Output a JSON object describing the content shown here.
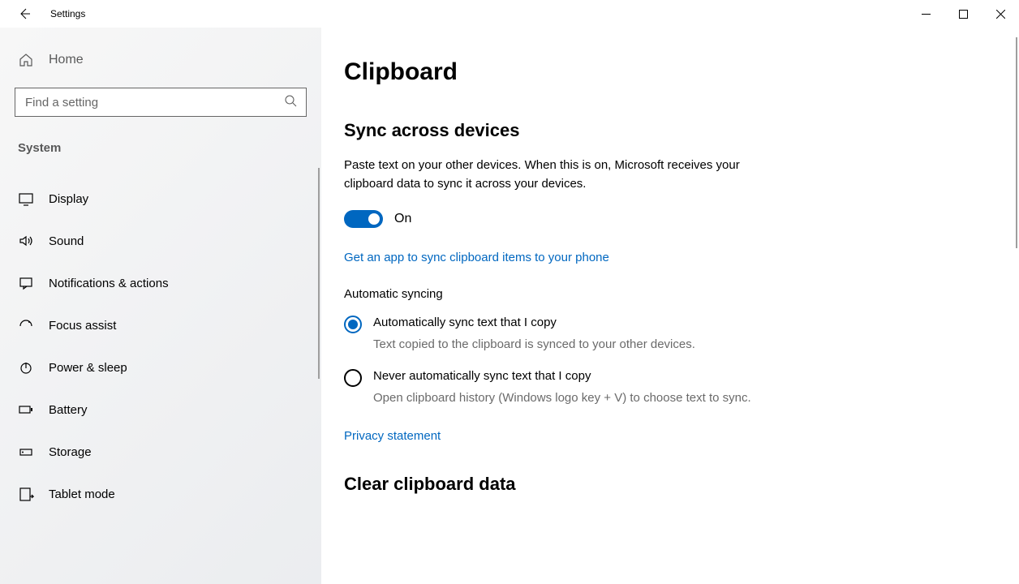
{
  "titlebar": {
    "title": "Settings"
  },
  "sidebar": {
    "home": "Home",
    "search_placeholder": "Find a setting",
    "category": "System",
    "items": [
      {
        "label": "Display"
      },
      {
        "label": "Sound"
      },
      {
        "label": "Notifications & actions"
      },
      {
        "label": "Focus assist"
      },
      {
        "label": "Power & sleep"
      },
      {
        "label": "Battery"
      },
      {
        "label": "Storage"
      },
      {
        "label": "Tablet mode"
      }
    ]
  },
  "main": {
    "title": "Clipboard",
    "sync": {
      "heading": "Sync across devices",
      "desc": "Paste text on your other devices. When this is on, Microsoft receives your clipboard data to sync it across your devices.",
      "toggle_state": "On",
      "app_link": "Get an app to sync clipboard items to your phone",
      "auto_heading": "Automatic syncing",
      "radios": [
        {
          "label": "Automatically sync text that I copy",
          "desc": "Text copied to the clipboard is synced to your other devices.",
          "selected": true
        },
        {
          "label": "Never automatically sync text that I copy",
          "desc": "Open clipboard history (Windows logo key + V) to choose text to sync.",
          "selected": false
        }
      ],
      "privacy_link": "Privacy statement"
    },
    "clear": {
      "heading": "Clear clipboard data"
    }
  }
}
